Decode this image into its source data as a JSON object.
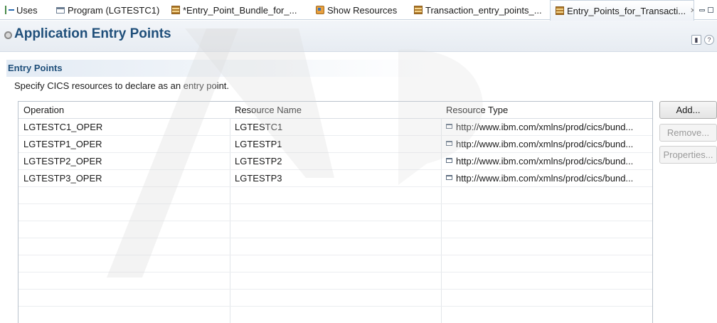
{
  "tabs": [
    {
      "label": "Uses",
      "icon": "uses-icon"
    },
    {
      "label": "Program (LGTESTC1)",
      "icon": "program-icon"
    },
    {
      "label": "*Entry_Point_Bundle_for_...",
      "icon": "bundle-icon"
    },
    {
      "label": "Show Resources",
      "icon": "resources-icon"
    },
    {
      "label": "Transaction_entry_points_...",
      "icon": "bundle-icon"
    },
    {
      "label": "Entry_Points_for_Transacti...",
      "icon": "bundle-icon",
      "active": true,
      "close": "✕"
    }
  ],
  "form": {
    "title": "Application Entry Points",
    "section_title": "Entry Points",
    "section_desc": "Specify CICS resources to declare as an entry point."
  },
  "table": {
    "columns": [
      "Operation",
      "Resource Name",
      "Resource Type"
    ],
    "rows": [
      [
        "LGTESTC1_OPER",
        "LGTESTC1",
        "http://www.ibm.com/xmlns/prod/cics/bund..."
      ],
      [
        "LGTESTP1_OPER",
        "LGTESTP1",
        "http://www.ibm.com/xmlns/prod/cics/bund..."
      ],
      [
        "LGTESTP2_OPER",
        "LGTESTP2",
        "http://www.ibm.com/xmlns/prod/cics/bund..."
      ],
      [
        "LGTESTP3_OPER",
        "LGTESTP3",
        "http://www.ibm.com/xmlns/prod/cics/bund..."
      ]
    ]
  },
  "buttons": {
    "add": "Add...",
    "remove": "Remove...",
    "properties": "Properties..."
  },
  "colors": {
    "title": "#1f4f7a",
    "border": "#b9c2cc"
  }
}
